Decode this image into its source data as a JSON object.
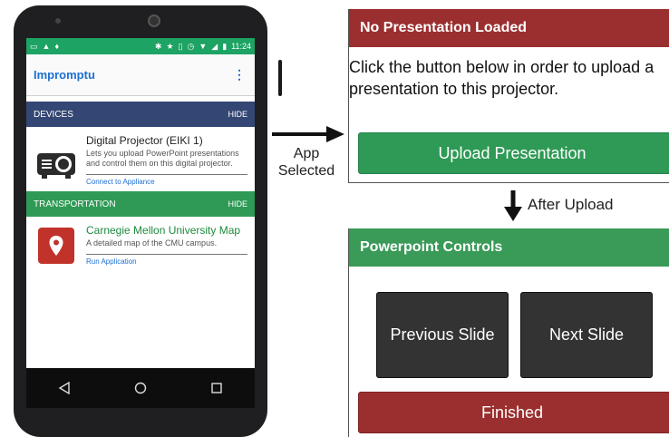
{
  "phone": {
    "status_bar": {
      "time": "11:24",
      "left_icons": [
        "cast-icon",
        "warning-icon",
        "pin-icon"
      ],
      "right_icons": [
        "bluetooth-icon",
        "star-icon",
        "vibrate-icon",
        "alarm-icon",
        "wifi-icon",
        "signal-icon",
        "battery-icon"
      ]
    },
    "app_title": "Impromptu",
    "categories": [
      {
        "label": "DEVICES",
        "hide_label": "HIDE",
        "color": "#344673",
        "item": {
          "name": "Digital Projector (EIKI 1)",
          "description": "Lets you upload PowerPoint presentations and control them on this digital projector.",
          "action": "Connect to Appliance",
          "icon": "projector-icon"
        }
      },
      {
        "label": "TRANSPORTATION",
        "hide_label": "HIDE",
        "color": "#2e9a55",
        "item": {
          "name": "Carnegie Mellon University Map",
          "description": "A detailed map of the CMU campus.",
          "action": "Run Application",
          "icon": "map-pin-icon"
        }
      }
    ],
    "nav": [
      "back-icon",
      "home-icon",
      "recents-icon"
    ]
  },
  "annotations": {
    "arrow_label_line1": "App",
    "arrow_label_line2": "Selected",
    "down_label": "After Upload"
  },
  "no_presentation_panel": {
    "header": "No Presentation Loaded",
    "text_line1": "Click the button below in order to upload a",
    "text_line2": "presentation to this projector.",
    "button": "Upload Presentation",
    "header_color": "#9b2f2f",
    "button_color": "#2e9a55"
  },
  "controls_panel": {
    "header": "Powerpoint Controls",
    "previous": "Previous Slide",
    "next": "Next Slide",
    "finished": "Finished",
    "header_color": "#3a9a58",
    "finished_color": "#9b2f2f"
  }
}
